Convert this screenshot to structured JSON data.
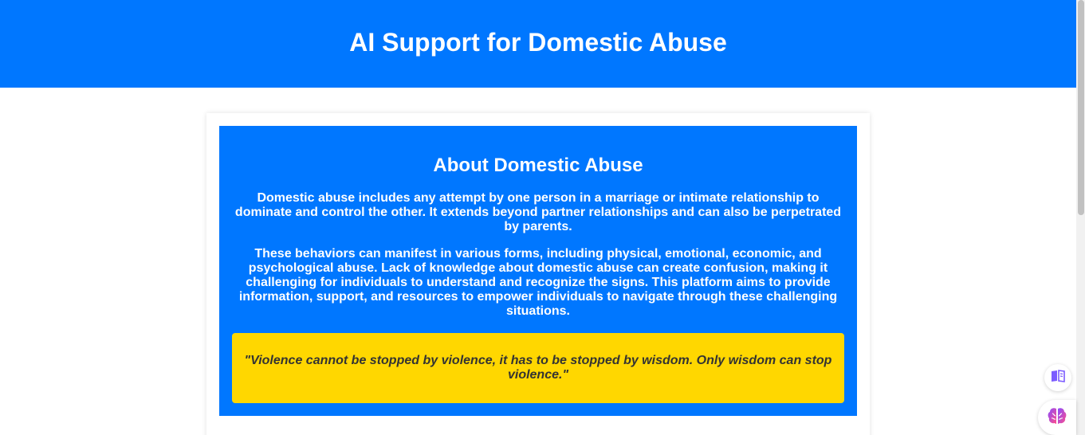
{
  "header": {
    "title": "AI Support for Domestic Abuse"
  },
  "about": {
    "heading": "About Domestic Abuse",
    "paragraph1": "Domestic abuse includes any attempt by one person in a marriage or intimate relationship to dominate and control the other. It extends beyond partner relationships and can also be perpetrated by parents.",
    "paragraph2": "These behaviors can manifest in various forms, including physical, emotional, economic, and psychological abuse. Lack of knowledge about domestic abuse can create confusion, making it challenging for individuals to understand and recognize the signs. This platform aims to provide information, support, and resources to empower individuals to navigate through these challenging situations.",
    "quote": "\"Violence cannot be stopped by violence, it has to be stopped by wisdom. Only wisdom can stop violence.\""
  },
  "colors": {
    "primary": "#0077ff",
    "quote_bg": "#ffd700",
    "quote_text": "#333333"
  },
  "icons": {
    "reader": "book-icon",
    "ai": "brain-icon"
  }
}
